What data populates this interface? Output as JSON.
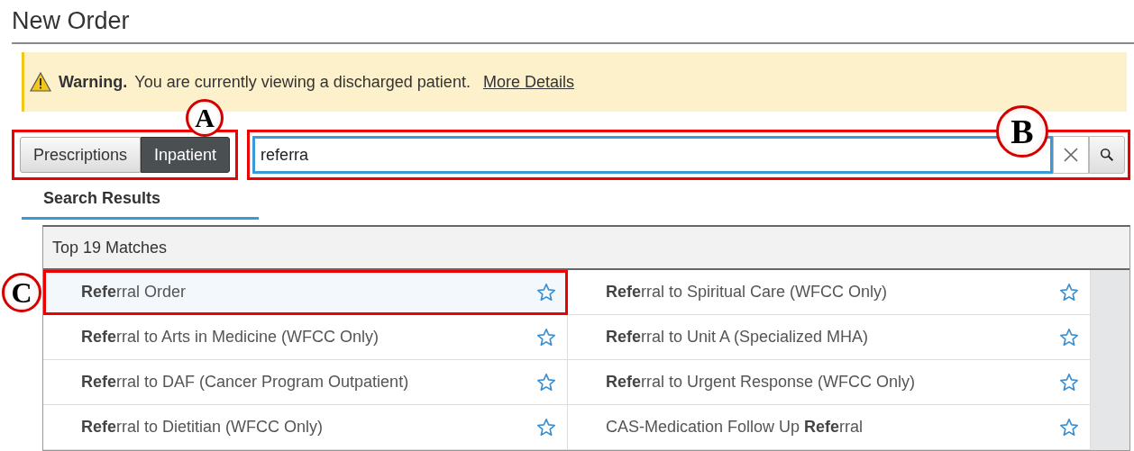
{
  "page_title": "New Order",
  "warning": {
    "label": "Warning.",
    "message": "You are currently viewing a discharged patient.",
    "link": "More Details"
  },
  "tabs": [
    {
      "label": "Prescriptions",
      "selected": false
    },
    {
      "label": "Inpatient",
      "selected": true
    }
  ],
  "search": {
    "value": "referra"
  },
  "results_tab": {
    "label": "Search Results",
    "selected": true
  },
  "results_header": "Top 19 Matches",
  "results": [
    {
      "text": "**Refe**rral Order",
      "selected": true
    },
    {
      "text": "**Refe**rral to Spiritual Care (WFCC Only)",
      "selected": false
    },
    {
      "text": "**Refe**rral to Arts in Medicine (WFCC Only)",
      "selected": false
    },
    {
      "text": "**Refe**rral to Unit A (Specialized MHA)",
      "selected": false
    },
    {
      "text": "**Refe**rral to DAF (Cancer Program Outpatient)",
      "selected": false
    },
    {
      "text": "**Refe**rral to Urgent Response (WFCC Only)",
      "selected": false
    },
    {
      "text": "**Refe**rral to Dietitian (WFCC Only)",
      "selected": false
    },
    {
      "text": "CAS-Medication Follow Up **Refe**rral",
      "selected": false
    }
  ],
  "callouts": [
    {
      "label": "A"
    },
    {
      "label": "B"
    },
    {
      "label": "C"
    }
  ]
}
